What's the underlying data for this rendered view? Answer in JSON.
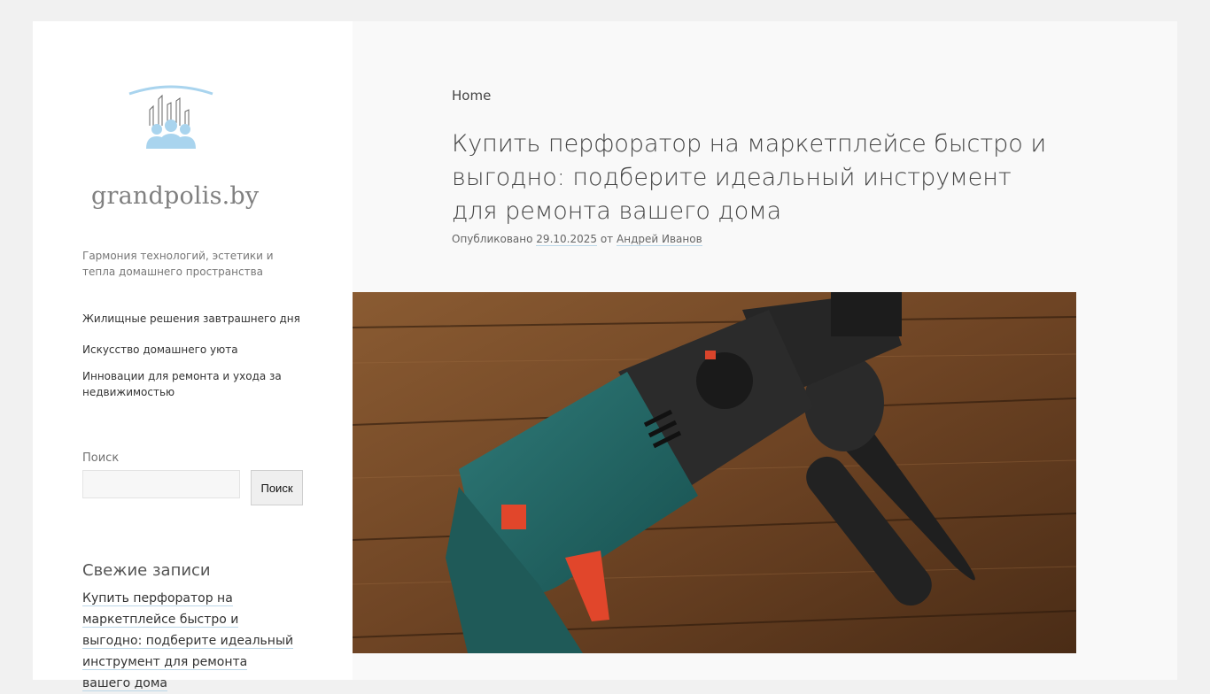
{
  "site": {
    "logo_text": "grandpolis.by",
    "tagline": "Гармония технологий, эстетики и тепла домашнего пространства"
  },
  "menu": {
    "items": [
      {
        "label": "Жилищные решения завтрашнего дня"
      },
      {
        "label": "Искусство домашнего уюта"
      },
      {
        "label": "Инновации для ремонта и ухода за недвижимостью"
      }
    ]
  },
  "search": {
    "label": "Поиск",
    "value": "",
    "placeholder": "",
    "button_label": "Поиск"
  },
  "recent": {
    "title": "Свежие записи",
    "items": [
      {
        "label": "Купить перфоратор на маркетплейсе быстро и выгодно: подберите идеальный инструмент для ремонта вашего дома"
      }
    ]
  },
  "post": {
    "breadcrumb": "Home",
    "title": "Купить перфоратор на маркетплейсе быстро и выгодно: подберите идеальный инструмент для ремонта вашего дома",
    "meta_published": "Опубликовано",
    "date": "29.10.2025",
    "meta_by": "от",
    "author": "Андрей Иванов",
    "image_icon": "hammer-drill-image"
  },
  "colors": {
    "page_bg": "#f1f1f1",
    "sidebar_bg": "#ffffff",
    "main_bg": "#f9f9f9",
    "logo_blue": "#a9d4ee",
    "link_underline": "#bcd7e8"
  }
}
